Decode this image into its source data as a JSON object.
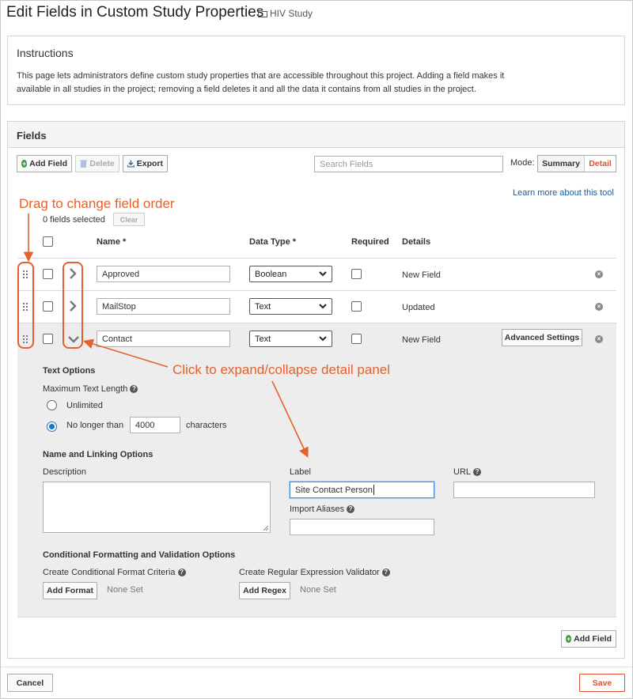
{
  "header": {
    "title": "Edit Fields in Custom Study Properties",
    "folder": "HIV Study"
  },
  "instructions": {
    "title": "Instructions",
    "line1": "This page lets administrators define custom study properties that are accessible throughout this project. Adding a field makes it",
    "line2": "available in all studies in the project; removing a field deletes it and all the data it contains from all studies in the project."
  },
  "fields": {
    "title": "Fields",
    "toolbar": {
      "add_field": "Add Field",
      "delete": "Delete",
      "export": "Export",
      "search_placeholder": "Search Fields",
      "mode_label": "Mode:",
      "mode_summary": "Summary",
      "mode_detail": "Detail"
    },
    "learn_more": "Learn more about this tool",
    "selected_count": "0 fields selected",
    "clear": "Clear",
    "columns": {
      "name": "Name *",
      "data_type": "Data Type *",
      "required": "Required",
      "details": "Details"
    },
    "rows": [
      {
        "name": "Approved",
        "type": "Boolean",
        "details": "New Field"
      },
      {
        "name": "MailStop",
        "type": "Text",
        "details": "Updated"
      },
      {
        "name": "Contact",
        "type": "Text",
        "details": "New Field"
      }
    ],
    "advanced_settings": "Advanced Settings",
    "detail": {
      "text_options": "Text Options",
      "max_length": "Maximum Text Length",
      "unlimited": "Unlimited",
      "no_longer_than": "No longer than",
      "max_value": "4000",
      "characters": "characters",
      "name_linking": "Name and Linking Options",
      "description": "Description",
      "label": "Label",
      "label_value": "Site Contact Person",
      "import_aliases": "Import Aliases",
      "url": "URL",
      "conditional_section": "Conditional Formatting and Validation Options",
      "create_format": "Create Conditional Format Criteria",
      "add_format": "Add Format",
      "format_none": "None Set",
      "create_regex": "Create Regular Expression Validator",
      "add_regex": "Add Regex",
      "regex_none": "None Set"
    },
    "add_field_bottom": "Add Field"
  },
  "footer": {
    "cancel": "Cancel",
    "save": "Save"
  },
  "annotations": {
    "drag": "Drag to change field order",
    "expand": "Click to expand/collapse detail panel"
  },
  "colors": {
    "annotation": "#e4612c",
    "link": "#1a5a98",
    "detail_bg": "#ededed",
    "add_icon": "#3c9a3c",
    "save": "#d9532c"
  }
}
